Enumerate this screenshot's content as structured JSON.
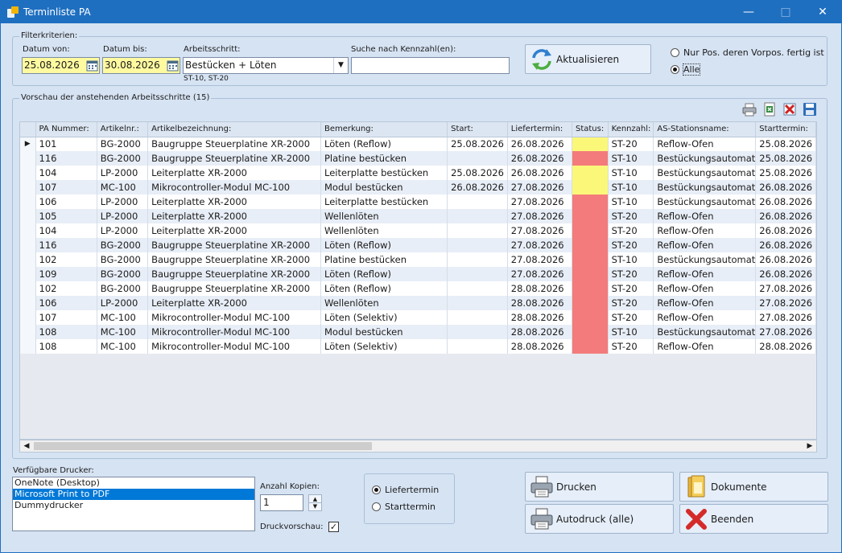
{
  "window": {
    "title": "Terminliste PA"
  },
  "filter": {
    "group_label": "Filterkriterien:",
    "date_from_label": "Datum von:",
    "date_from": "25.08.2026",
    "date_to_label": "Datum bis:",
    "date_to": "30.08.2026",
    "step_label": "Arbeitsschritt:",
    "step_value": "Bestücken + Löten",
    "step_codes": "ST-10, ST-20",
    "search_label": "Suche nach Kennzahl(en):",
    "search_value": "",
    "refresh_label": "Aktualisieren",
    "radio_prev_done": "Nur Pos. deren Vorpos. fertig ist",
    "radio_all": "Alle"
  },
  "preview": {
    "group_label": "Vorschau der anstehenden Arbeitsschritte (15)",
    "columns": [
      "PA Nummer:",
      "Artikelnr.:",
      "Artikelbezeichnung:",
      "Bemerkung:",
      "Start:",
      "Liefertermin:",
      "Status:",
      "Kennzahl:",
      "AS-Stationsname:",
      "Starttermin:"
    ],
    "rows": [
      [
        "101",
        "BG-2000",
        "Baugruppe Steuerplatine XR-2000",
        "Löten (Reflow)",
        "25.08.2026",
        "26.08.2026",
        "yellow",
        "ST-20",
        "Reflow-Ofen",
        "25.08.2026"
      ],
      [
        "116",
        "BG-2000",
        "Baugruppe Steuerplatine XR-2000",
        "Platine bestücken",
        "",
        "26.08.2026",
        "red",
        "ST-10",
        "Bestückungsautomat",
        "25.08.2026"
      ],
      [
        "104",
        "LP-2000",
        "Leiterplatte XR-2000",
        "Leiterplatte bestücken",
        "25.08.2026",
        "26.08.2026",
        "yellow",
        "ST-10",
        "Bestückungsautomat",
        "25.08.2026"
      ],
      [
        "107",
        "MC-100",
        "Mikrocontroller-Modul MC-100",
        "Modul bestücken",
        "26.08.2026",
        "27.08.2026",
        "yellow",
        "ST-10",
        "Bestückungsautomat",
        "26.08.2026"
      ],
      [
        "106",
        "LP-2000",
        "Leiterplatte XR-2000",
        "Leiterplatte bestücken",
        "",
        "27.08.2026",
        "red",
        "ST-10",
        "Bestückungsautomat",
        "26.08.2026"
      ],
      [
        "105",
        "LP-2000",
        "Leiterplatte XR-2000",
        "Wellenlöten",
        "",
        "27.08.2026",
        "red",
        "ST-20",
        "Reflow-Ofen",
        "26.08.2026"
      ],
      [
        "104",
        "LP-2000",
        "Leiterplatte XR-2000",
        "Wellenlöten",
        "",
        "27.08.2026",
        "red",
        "ST-20",
        "Reflow-Ofen",
        "26.08.2026"
      ],
      [
        "116",
        "BG-2000",
        "Baugruppe Steuerplatine XR-2000",
        "Löten (Reflow)",
        "",
        "27.08.2026",
        "red",
        "ST-20",
        "Reflow-Ofen",
        "26.08.2026"
      ],
      [
        "102",
        "BG-2000",
        "Baugruppe Steuerplatine XR-2000",
        "Platine bestücken",
        "",
        "27.08.2026",
        "red",
        "ST-10",
        "Bestückungsautomat",
        "26.08.2026"
      ],
      [
        "109",
        "BG-2000",
        "Baugruppe Steuerplatine XR-2000",
        "Löten (Reflow)",
        "",
        "27.08.2026",
        "red",
        "ST-20",
        "Reflow-Ofen",
        "26.08.2026"
      ],
      [
        "102",
        "BG-2000",
        "Baugruppe Steuerplatine XR-2000",
        "Löten (Reflow)",
        "",
        "28.08.2026",
        "red",
        "ST-20",
        "Reflow-Ofen",
        "27.08.2026"
      ],
      [
        "106",
        "LP-2000",
        "Leiterplatte XR-2000",
        "Wellenlöten",
        "",
        "28.08.2026",
        "red",
        "ST-20",
        "Reflow-Ofen",
        "27.08.2026"
      ],
      [
        "107",
        "MC-100",
        "Mikrocontroller-Modul MC-100",
        "Löten (Selektiv)",
        "",
        "28.08.2026",
        "red",
        "ST-20",
        "Reflow-Ofen",
        "27.08.2026"
      ],
      [
        "108",
        "MC-100",
        "Mikrocontroller-Modul MC-100",
        "Modul bestücken",
        "",
        "28.08.2026",
        "red",
        "ST-10",
        "Bestückungsautomat",
        "27.08.2026"
      ],
      [
        "108",
        "MC-100",
        "Mikrocontroller-Modul MC-100",
        "Löten (Selektiv)",
        "",
        "28.08.2026",
        "red",
        "ST-20",
        "Reflow-Ofen",
        "28.08.2026"
      ]
    ],
    "status_colors": {
      "yellow": "#fbf879",
      "red": "#f37b7b"
    }
  },
  "bottom": {
    "printers_label": "Verfügbare Drucker:",
    "printers": [
      "OneNote (Desktop)",
      "Microsoft Print to PDF",
      "Dummydrucker"
    ],
    "selected_printer": "Microsoft Print to PDF",
    "copies_label": "Anzahl Kopien:",
    "copies": "1",
    "preview_label": "Druckvorschau:",
    "sort_delivery": "Liefertermin",
    "sort_start": "Starttermin",
    "print_label": "Drucken",
    "autoprint_label": "Autodruck (alle)",
    "documents_label": "Dokumente",
    "exit_label": "Beenden"
  }
}
